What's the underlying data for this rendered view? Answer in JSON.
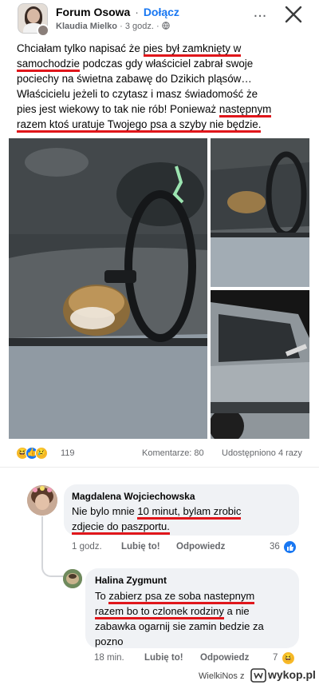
{
  "post": {
    "group_name": "Forum Osowa",
    "dot": "·",
    "join_label": "Dołącz",
    "author": "Klaudia Mielko",
    "time": "· 3 godz. ·",
    "more_label": "...",
    "text_lines": [
      [
        "Chciałam tylko napisać że ",
        "pies był zamknięty w",
        ""
      ],
      [
        "",
        "samochodzie",
        " podczas gdy właściciel zabrał swoje"
      ],
      [
        "pociechy na świetna zabawę do Dzikich pląsów…",
        "",
        ""
      ],
      [
        "Właścicielu jeżeli to czytasz i masz świadomość że",
        "",
        ""
      ],
      [
        "pies jest wiekowy to tak nie rób! Ponieważ ",
        "następnym",
        ""
      ],
      [
        "",
        "razem ktoś uratuje Twojego psa a szyby nie będzie.",
        ""
      ]
    ],
    "reactions_count": "119",
    "comments_count": "Komentarze: 80",
    "shares_count": "Udostępniono 4 razy"
  },
  "comments": [
    {
      "author": "Magdalena Wojciechowska",
      "line1_plain": "Nie bylo mnie ",
      "line1_ul": "10 minut, bylam zrobic",
      "line2_ul": "zdjecie do paszportu.",
      "time": "1 godz.",
      "like": "Lubię to!",
      "reply": "Odpowiedz",
      "likes": "36"
    },
    {
      "author": "Halina Zygmunt",
      "line1_plain": "To ",
      "line1_ul": "zabierz psa ze soba nastepnym",
      "line2_ul": "razem bo to czlonek rodziny",
      "line2_plain": " a nie",
      "line3": "zabawka ogarnij sie  zamin bedzie za",
      "line4": "pozno",
      "time": "18 min.",
      "like": "Lubię to!",
      "reply": "Odpowiedz",
      "likes": "7"
    }
  ],
  "footer": {
    "source": "WielkiNos z",
    "site": "wykop.pl"
  },
  "colors": {
    "accent": "#1877f2",
    "underline": "#e0161b",
    "secondary_text": "#65676b"
  }
}
